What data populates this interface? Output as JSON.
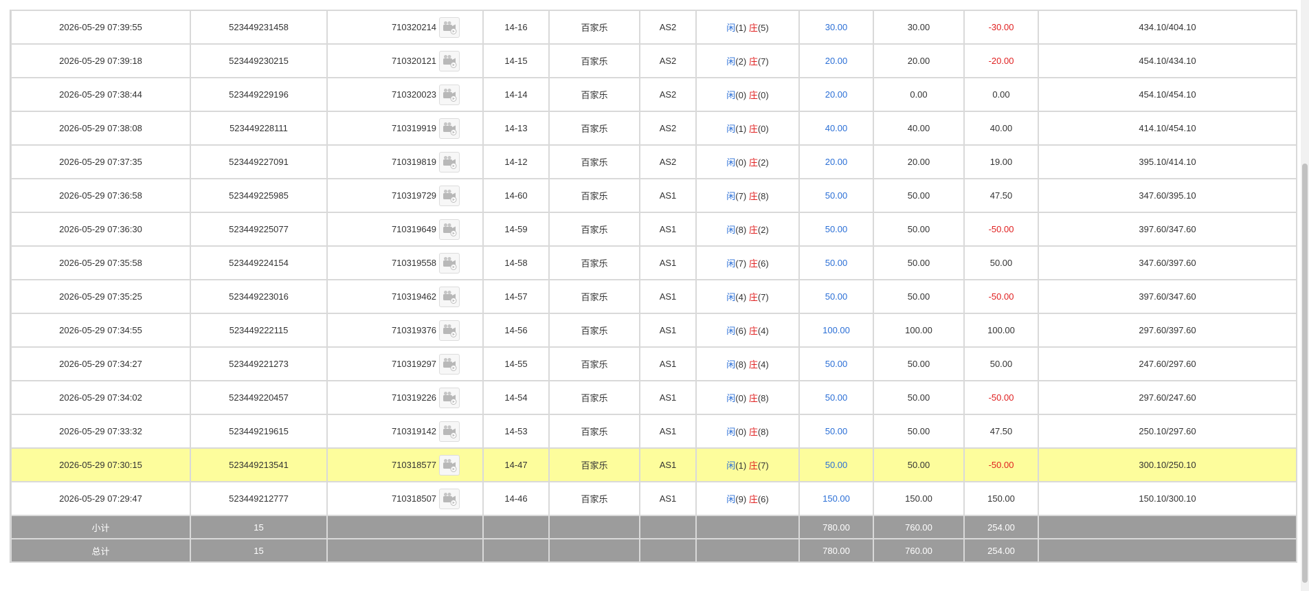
{
  "colors": {
    "player": "#2b6fd6",
    "banker": "#e02020",
    "highlight_row": "#fdfd9c",
    "summary_bg": "#9c9c9c"
  },
  "icons": {
    "video": "video-camera-icon"
  },
  "rows": [
    {
      "time": "2026-05-29 07:39:55",
      "bet_id": "523449231458",
      "game_id": "710320214",
      "shoe": "14-16",
      "game_type": "百家乐",
      "table": "AS2",
      "player_label": "闲",
      "player_score": "(1)",
      "banker_label": "庄",
      "banker_score": "(5)",
      "bet": "30.00",
      "valid": "30.00",
      "win": "-30.00",
      "win_negative": true,
      "balance": "434.10/404.10"
    },
    {
      "time": "2026-05-29 07:39:18",
      "bet_id": "523449230215",
      "game_id": "710320121",
      "shoe": "14-15",
      "game_type": "百家乐",
      "table": "AS2",
      "player_label": "闲",
      "player_score": "(2)",
      "banker_label": "庄",
      "banker_score": "(7)",
      "bet": "20.00",
      "valid": "20.00",
      "win": "-20.00",
      "win_negative": true,
      "balance": "454.10/434.10"
    },
    {
      "time": "2026-05-29 07:38:44",
      "bet_id": "523449229196",
      "game_id": "710320023",
      "shoe": "14-14",
      "game_type": "百家乐",
      "table": "AS2",
      "player_label": "闲",
      "player_score": "(0)",
      "banker_label": "庄",
      "banker_score": "(0)",
      "bet": "20.00",
      "valid": "0.00",
      "win": "0.00",
      "win_negative": false,
      "balance": "454.10/454.10"
    },
    {
      "time": "2026-05-29 07:38:08",
      "bet_id": "523449228111",
      "game_id": "710319919",
      "shoe": "14-13",
      "game_type": "百家乐",
      "table": "AS2",
      "player_label": "闲",
      "player_score": "(1)",
      "banker_label": "庄",
      "banker_score": "(0)",
      "bet": "40.00",
      "valid": "40.00",
      "win": "40.00",
      "win_negative": false,
      "balance": "414.10/454.10"
    },
    {
      "time": "2026-05-29 07:37:35",
      "bet_id": "523449227091",
      "game_id": "710319819",
      "shoe": "14-12",
      "game_type": "百家乐",
      "table": "AS2",
      "player_label": "闲",
      "player_score": "(0)",
      "banker_label": "庄",
      "banker_score": "(2)",
      "bet": "20.00",
      "valid": "20.00",
      "win": "19.00",
      "win_negative": false,
      "balance": "395.10/414.10"
    },
    {
      "time": "2026-05-29 07:36:58",
      "bet_id": "523449225985",
      "game_id": "710319729",
      "shoe": "14-60",
      "game_type": "百家乐",
      "table": "AS1",
      "player_label": "闲",
      "player_score": "(7)",
      "banker_label": "庄",
      "banker_score": "(8)",
      "bet": "50.00",
      "valid": "50.00",
      "win": "47.50",
      "win_negative": false,
      "balance": "347.60/395.10"
    },
    {
      "time": "2026-05-29 07:36:30",
      "bet_id": "523449225077",
      "game_id": "710319649",
      "shoe": "14-59",
      "game_type": "百家乐",
      "table": "AS1",
      "player_label": "闲",
      "player_score": "(8)",
      "banker_label": "庄",
      "banker_score": "(2)",
      "bet": "50.00",
      "valid": "50.00",
      "win": "-50.00",
      "win_negative": true,
      "balance": "397.60/347.60"
    },
    {
      "time": "2026-05-29 07:35:58",
      "bet_id": "523449224154",
      "game_id": "710319558",
      "shoe": "14-58",
      "game_type": "百家乐",
      "table": "AS1",
      "player_label": "闲",
      "player_score": "(7)",
      "banker_label": "庄",
      "banker_score": "(6)",
      "bet": "50.00",
      "valid": "50.00",
      "win": "50.00",
      "win_negative": false,
      "balance": "347.60/397.60"
    },
    {
      "time": "2026-05-29 07:35:25",
      "bet_id": "523449223016",
      "game_id": "710319462",
      "shoe": "14-57",
      "game_type": "百家乐",
      "table": "AS1",
      "player_label": "闲",
      "player_score": "(4)",
      "banker_label": "庄",
      "banker_score": "(7)",
      "bet": "50.00",
      "valid": "50.00",
      "win": "-50.00",
      "win_negative": true,
      "balance": "397.60/347.60"
    },
    {
      "time": "2026-05-29 07:34:55",
      "bet_id": "523449222115",
      "game_id": "710319376",
      "shoe": "14-56",
      "game_type": "百家乐",
      "table": "AS1",
      "player_label": "闲",
      "player_score": "(6)",
      "banker_label": "庄",
      "banker_score": "(4)",
      "bet": "100.00",
      "valid": "100.00",
      "win": "100.00",
      "win_negative": false,
      "balance": "297.60/397.60"
    },
    {
      "time": "2026-05-29 07:34:27",
      "bet_id": "523449221273",
      "game_id": "710319297",
      "shoe": "14-55",
      "game_type": "百家乐",
      "table": "AS1",
      "player_label": "闲",
      "player_score": "(8)",
      "banker_label": "庄",
      "banker_score": "(4)",
      "bet": "50.00",
      "valid": "50.00",
      "win": "50.00",
      "win_negative": false,
      "balance": "247.60/297.60"
    },
    {
      "time": "2026-05-29 07:34:02",
      "bet_id": "523449220457",
      "game_id": "710319226",
      "shoe": "14-54",
      "game_type": "百家乐",
      "table": "AS1",
      "player_label": "闲",
      "player_score": "(0)",
      "banker_label": "庄",
      "banker_score": "(8)",
      "bet": "50.00",
      "valid": "50.00",
      "win": "-50.00",
      "win_negative": true,
      "balance": "297.60/247.60"
    },
    {
      "time": "2026-05-29 07:33:32",
      "bet_id": "523449219615",
      "game_id": "710319142",
      "shoe": "14-53",
      "game_type": "百家乐",
      "table": "AS1",
      "player_label": "闲",
      "player_score": "(0)",
      "banker_label": "庄",
      "banker_score": "(8)",
      "bet": "50.00",
      "valid": "50.00",
      "win": "47.50",
      "win_negative": false,
      "balance": "250.10/297.60"
    },
    {
      "time": "2026-05-29 07:30:15",
      "bet_id": "523449213541",
      "game_id": "710318577",
      "shoe": "14-47",
      "game_type": "百家乐",
      "table": "AS1",
      "player_label": "闲",
      "player_score": "(1)",
      "banker_label": "庄",
      "banker_score": "(7)",
      "bet": "50.00",
      "valid": "50.00",
      "win": "-50.00",
      "win_negative": true,
      "balance": "300.10/250.10",
      "highlighted": true
    },
    {
      "time": "2026-05-29 07:29:47",
      "bet_id": "523449212777",
      "game_id": "710318507",
      "shoe": "14-46",
      "game_type": "百家乐",
      "table": "AS1",
      "player_label": "闲",
      "player_score": "(9)",
      "banker_label": "庄",
      "banker_score": "(6)",
      "bet": "150.00",
      "valid": "150.00",
      "win": "150.00",
      "win_negative": false,
      "balance": "150.10/300.10"
    }
  ],
  "subtotal": {
    "label": "小计",
    "count": "15",
    "bet": "780.00",
    "valid": "760.00",
    "win": "254.00"
  },
  "total": {
    "label": "总计",
    "count": "15",
    "bet": "780.00",
    "valid": "760.00",
    "win": "254.00"
  }
}
